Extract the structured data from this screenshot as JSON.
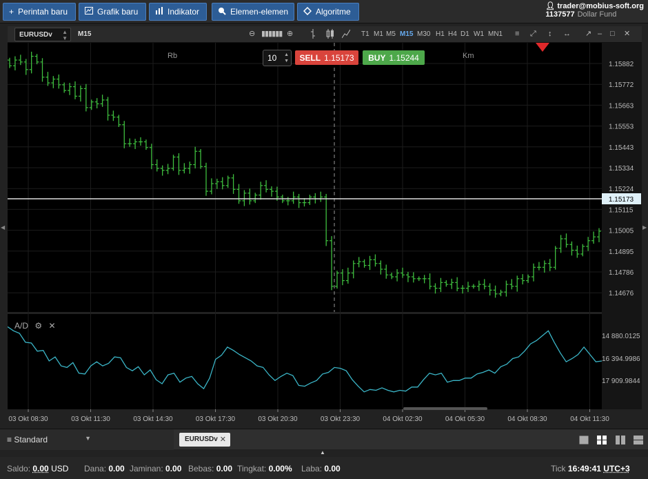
{
  "toolbar": {
    "buttons": [
      {
        "label": "Perintah baru",
        "icon": "plus-icon"
      },
      {
        "label": "Grafik baru",
        "icon": "chart-icon"
      },
      {
        "label": "Indikator",
        "icon": "bars-icon"
      },
      {
        "label": "Elemen-elemen",
        "icon": "cursor-icon"
      },
      {
        "label": "Algoritme",
        "icon": "diamond-icon"
      }
    ],
    "account_email": "trader@mobius-soft.org",
    "account_id": "1137577",
    "account_type": "Dollar Fund"
  },
  "chart_toolbar": {
    "symbol": "EURUSDv",
    "current_tf": "M15",
    "timeframes": [
      "T1",
      "M1",
      "M5",
      "M15",
      "M30",
      "H1",
      "H4",
      "D1",
      "W1",
      "MN1"
    ],
    "active_tf": "M15"
  },
  "trade": {
    "quantity": "10",
    "sell_label": "SELL",
    "sell_price": "1.15173",
    "buy_label": "BUY",
    "buy_price": "1.15244"
  },
  "chart_labels": {
    "left": "Rb",
    "right": "Km"
  },
  "indicator": {
    "name": "A/D"
  },
  "colors": {
    "bull": "#3fbf3f",
    "ad_line": "#3bb6c8",
    "sell": "#d9443c",
    "buy": "#4da84a",
    "marker": "#e0282a"
  },
  "chart_data": {
    "type": "candlestick",
    "price_axis": [
      "1.15882",
      "1.15772",
      "1.15663",
      "1.15553",
      "1.15443",
      "1.15334",
      "1.15224",
      "1.15115",
      "1.15005",
      "1.14895",
      "1.14786",
      "1.14676"
    ],
    "current_price": "1.15173",
    "ad_axis": [
      "14 880.0125",
      "16 394.9986",
      "17 909.9844"
    ],
    "time_axis": [
      "03 Okt 08:30",
      "03 Okt 11:30",
      "03 Okt 14:30",
      "03 Okt 17:30",
      "03 Okt 20:30",
      "03 Okt 23:30",
      "04 Okt 02:30",
      "04 Okt 05:30",
      "04 Okt 08:30",
      "04 Okt 11:30"
    ],
    "close": [
      1.1587,
      1.159,
      1.1589,
      1.1585,
      1.1592,
      1.1589,
      1.1581,
      1.1578,
      1.158,
      1.1577,
      1.1574,
      1.1576,
      1.1571,
      1.1575,
      1.1565,
      1.1568,
      1.1567,
      1.1569,
      1.1561,
      1.156,
      1.1556,
      1.1546,
      1.1546,
      1.1547,
      1.1547,
      1.1544,
      1.1535,
      1.1533,
      1.1532,
      1.1533,
      1.1539,
      1.1532,
      1.1533,
      1.1535,
      1.1542,
      1.1534,
      1.1521,
      1.1525,
      1.1526,
      1.1524,
      1.1528,
      1.1522,
      1.1516,
      1.152,
      1.1516,
      1.1519,
      1.1524,
      1.1522,
      1.1521,
      1.1518,
      1.1516,
      1.1516,
      1.1518,
      1.1515,
      1.1515,
      1.1518,
      1.1517,
      1.1518,
      1.1495,
      1.1471,
      1.1478,
      1.1474,
      1.1478,
      1.1483,
      1.1484,
      1.1482,
      1.1485,
      1.1483,
      1.148,
      1.1477,
      1.1476,
      1.1478,
      1.1477,
      1.1476,
      1.1475,
      1.1475,
      1.1475,
      1.1471,
      1.147,
      1.1473,
      1.1472,
      1.1473,
      1.147,
      1.147,
      1.1471,
      1.1471,
      1.1472,
      1.1471,
      1.1469,
      1.1467,
      1.1468,
      1.1472,
      1.1471,
      1.1475,
      1.1474,
      1.1476,
      1.1481,
      1.1481,
      1.1483,
      1.1481,
      1.1491,
      1.1496,
      1.1493,
      1.149,
      1.1488,
      1.1492,
      1.1495,
      1.1497,
      1.15
    ],
    "ad": [
      0.92,
      0.87,
      0.84,
      0.73,
      0.72,
      0.62,
      0.63,
      0.5,
      0.55,
      0.44,
      0.42,
      0.48,
      0.35,
      0.34,
      0.44,
      0.49,
      0.44,
      0.47,
      0.55,
      0.54,
      0.42,
      0.38,
      0.43,
      0.33,
      0.39,
      0.27,
      0.22,
      0.33,
      0.35,
      0.24,
      0.29,
      0.31,
      0.22,
      0.16,
      0.29,
      0.52,
      0.57,
      0.67,
      0.63,
      0.58,
      0.54,
      0.5,
      0.44,
      0.42,
      0.33,
      0.26,
      0.31,
      0.35,
      0.32,
      0.2,
      0.19,
      0.23,
      0.26,
      0.34,
      0.36,
      0.42,
      0.41,
      0.38,
      0.27,
      0.19,
      0.12,
      0.15,
      0.14,
      0.17,
      0.14,
      0.12,
      0.14,
      0.13,
      0.18,
      0.18,
      0.27,
      0.35,
      0.33,
      0.35,
      0.24,
      0.26,
      0.26,
      0.29,
      0.29,
      0.34,
      0.36,
      0.39,
      0.35,
      0.43,
      0.46,
      0.53,
      0.55,
      0.62,
      0.71,
      0.75,
      0.81,
      0.87,
      0.73,
      0.6,
      0.49,
      0.53,
      0.58,
      0.67,
      0.58,
      0.49,
      0.5
    ]
  },
  "tabs": {
    "workspace": "Standard",
    "symbol_tab": "EURUSDv"
  },
  "status": {
    "saldo_label": "Saldo:",
    "saldo": "0.00",
    "saldo_cur": "USD",
    "dana_label": "Dana:",
    "dana": "0.00",
    "jaminan_label": "Jaminan:",
    "jaminan": "0.00",
    "bebas_label": "Bebas:",
    "bebas": "0.00",
    "tingkat_label": "Tingkat:",
    "tingkat": "0.00%",
    "laba_label": "Laba:",
    "laba": "0.00",
    "tick_label": "Tick",
    "time": "16:49:41",
    "tz": "UTC+3"
  }
}
